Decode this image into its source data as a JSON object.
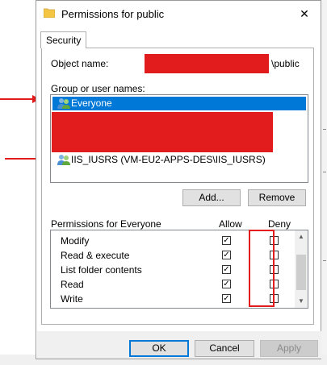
{
  "window": {
    "title": "Permissions for public",
    "close_glyph": "✕"
  },
  "tabs": [
    {
      "label": "Security"
    }
  ],
  "object": {
    "label": "Object name:",
    "value_suffix": "\\public"
  },
  "groups": {
    "label": "Group or user names:",
    "items": [
      {
        "label": "Everyone",
        "selected": true,
        "icon": "users-icon"
      },
      {
        "label": "IIS_IUSRS (VM-EU2-APPS-DES\\IIS_IUSRS)",
        "selected": false,
        "icon": "users-icon"
      }
    ]
  },
  "buttons": {
    "add": "Add...",
    "remove": "Remove",
    "ok": "OK",
    "cancel": "Cancel",
    "apply": "Apply"
  },
  "permissions": {
    "header": "Permissions for Everyone",
    "allow_header": "Allow",
    "deny_header": "Deny",
    "rows": [
      {
        "name": "Modify",
        "allow": true,
        "deny": false
      },
      {
        "name": "Read & execute",
        "allow": true,
        "deny": false
      },
      {
        "name": "List folder contents",
        "allow": true,
        "deny": false
      },
      {
        "name": "Read",
        "allow": true,
        "deny": false
      },
      {
        "name": "Write",
        "allow": true,
        "deny": false
      }
    ]
  },
  "colors": {
    "selection": "#0078d7",
    "annotation_red": "#e21c1c"
  }
}
